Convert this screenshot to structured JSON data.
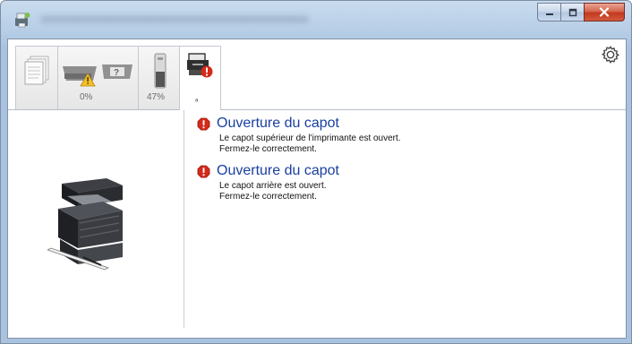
{
  "window": {
    "title_visible": false,
    "colors": {
      "frame": "#a8c2df",
      "close_button": "#c8452a",
      "message_title": "#1a3fa0",
      "alert_icon": "#d42a1a"
    }
  },
  "titlebar_buttons": [
    {
      "name": "minimize",
      "icon": "minimize-icon"
    },
    {
      "name": "maximize",
      "icon": "maximize-icon"
    },
    {
      "name": "close",
      "icon": "close-icon"
    }
  ],
  "toolbar": {
    "tabs": [
      {
        "id": "paper",
        "icon": "paper-stack-icon",
        "label": ""
      },
      {
        "id": "toner-warning",
        "icon": "toner-warning-icon",
        "label": "0%"
      },
      {
        "id": "toner-level",
        "icon": "toner-cartridge-icon",
        "label": "47%"
      },
      {
        "id": "device-status",
        "icon": "printer-alert-icon",
        "label": "",
        "active": true
      }
    ],
    "settings_icon": "gear-icon"
  },
  "messages": [
    {
      "icon": "alert-icon",
      "title": "Ouverture du capot",
      "lines": [
        "Le capot supérieur de l'imprimante est ouvert.",
        "Fermez-le correctement."
      ]
    },
    {
      "icon": "alert-icon",
      "title": "Ouverture du capot",
      "lines": [
        "Le capot arrière est ouvert.",
        "Fermez-le correctement."
      ]
    }
  ]
}
